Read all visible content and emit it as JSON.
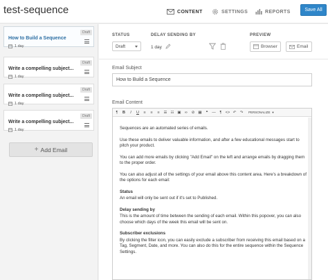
{
  "header": {
    "title": "test-sequence",
    "tabs": [
      {
        "label": "CONTENT",
        "icon": "envelope-icon",
        "active": true
      },
      {
        "label": "SETTINGS",
        "icon": "gear-icon",
        "active": false
      },
      {
        "label": "REPORTS",
        "icon": "bar-chart-icon",
        "active": false
      }
    ],
    "save_label": "Save All"
  },
  "sidebar": {
    "emails": [
      {
        "title": "How to Build a Sequence",
        "badge": "Draft",
        "delay": "1 day",
        "selected": true
      },
      {
        "title": "Write a compelling subject...",
        "badge": "Draft",
        "delay": "1 day",
        "selected": false
      },
      {
        "title": "Write a compelling subject...",
        "badge": "Draft",
        "delay": "1 day",
        "selected": false
      },
      {
        "title": "Write a compelling subject...",
        "badge": "Draft",
        "delay": "1 day",
        "selected": false
      }
    ],
    "add_label": "Add Email"
  },
  "settings": {
    "status_label": "STATUS",
    "status_value": "Draft",
    "delay_label": "DELAY SENDING BY",
    "delay_value": "1 day",
    "preview_label": "PREVIEW",
    "browser_label": "Browser",
    "email_label": "Email"
  },
  "subject": {
    "label": "Email Subject",
    "value": "How to Build a Sequence"
  },
  "content": {
    "label": "Email Content",
    "personalize": "PERSONALIZE",
    "paragraphs": [
      "Sequences are an automated series of emails.",
      "Use these emails to deliver valuable information, and after a few educational messages start to pitch your product.",
      "You can add more emails by clicking \"Add Email\" on the left and arrange emails by dragging them to the proper order.",
      "You can also adjust all of the settings of your email above this content area. Here's a breakdown of the options for each email:"
    ],
    "sections": [
      {
        "heading": "Status",
        "text": "An email will only be sent out if it's set to Published."
      },
      {
        "heading": "Delay sending by",
        "text": "This is the amount of time between the sending of each email. Within this popover, you can also choose which days of the week this email will be sent on."
      },
      {
        "heading": "Subscriber exclusions",
        "text": "By clicking the filter icon, you can easily exclude a subscriber from receiving this email based on a Tag, Segment, Date, and more. You can also do this for the entire sequence within the Sequence Settings."
      }
    ]
  },
  "colors": {
    "accent": "#2f86c9",
    "selected_title": "#2c6ea3"
  }
}
